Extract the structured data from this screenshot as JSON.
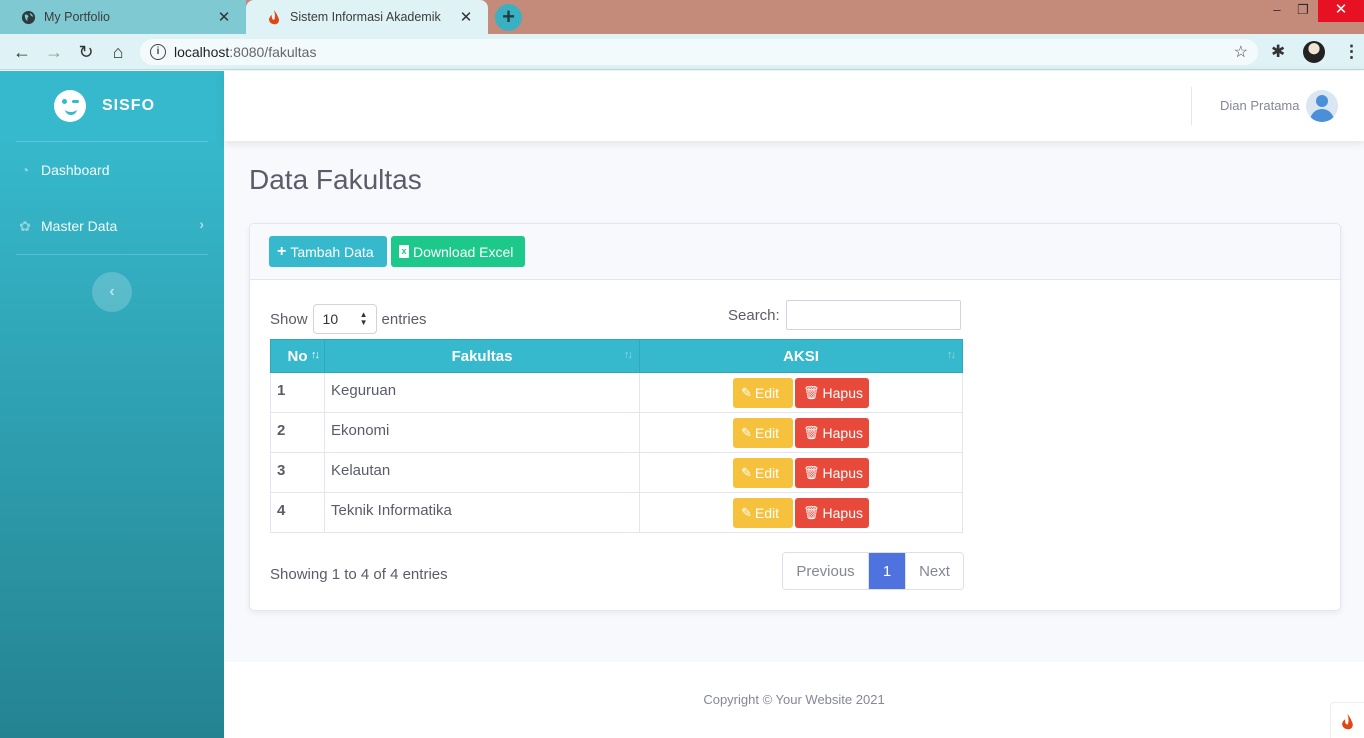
{
  "browser": {
    "tabs": [
      {
        "title": "My Portfolio",
        "icon": "globe-icon"
      },
      {
        "title": "Sistem Informasi Akademik",
        "icon": "codeigniter-flame-icon"
      }
    ],
    "new_tab": "+",
    "url_host": "localhost",
    "url_path": ":8080/fakultas",
    "win_min": "–",
    "win_max": "❐",
    "win_close": "✕"
  },
  "sidebar": {
    "brand": "SISFO",
    "items": [
      {
        "label": "Dashboard",
        "icon": "tachometer-icon"
      },
      {
        "label": "Master Data",
        "icon": "cog-icon"
      }
    ],
    "toggle": "‹"
  },
  "topbar": {
    "user_name": "Dian Pratama"
  },
  "page": {
    "title": "Data Fakultas",
    "add_button": "Tambah Data",
    "download_button": "Download Excel"
  },
  "datatable": {
    "show_label": "Show",
    "entries_label": "entries",
    "page_length": "10",
    "search_label": "Search:",
    "search_value": "",
    "columns": [
      "No",
      "Fakultas",
      "AKSI"
    ],
    "rows": [
      {
        "no": "1",
        "fakultas": "Keguruan"
      },
      {
        "no": "2",
        "fakultas": "Ekonomi"
      },
      {
        "no": "3",
        "fakultas": "Kelautan"
      },
      {
        "no": "4",
        "fakultas": "Teknik Informatika"
      }
    ],
    "edit_label": "Edit",
    "delete_label": "Hapus",
    "info": "Showing 1 to 4 of 4 entries",
    "pagination": {
      "previous": "Previous",
      "current": "1",
      "next": "Next"
    }
  },
  "footer": {
    "copyright": "Copyright © Your Website 2021"
  },
  "colors": {
    "primary": "#4e73df",
    "info": "#36b9cc",
    "success": "#1cc88a",
    "warning": "#f6c23e",
    "danger": "#e74a3b"
  }
}
